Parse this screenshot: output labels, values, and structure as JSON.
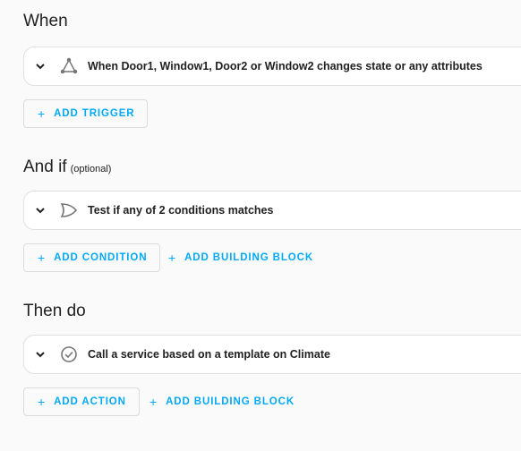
{
  "triggers": {
    "title": "When",
    "card_text": "When Door1, Window1, Door2 or Window2 changes state or any attributes",
    "card_icon": "trigger-state-icon",
    "add_trigger_label": "ADD TRIGGER"
  },
  "conditions": {
    "title": "And if",
    "subtitle": "(optional)",
    "card_text": "Test if any of 2 conditions matches",
    "card_icon": "or-gate-icon",
    "add_condition_label": "ADD CONDITION",
    "add_building_block_label": "ADD BUILDING BLOCK"
  },
  "actions": {
    "title": "Then do",
    "card_text": "Call a service based on a template on Climate",
    "card_icon": "check-circle-icon",
    "add_action_label": "ADD ACTION",
    "add_building_block_label": "ADD BUILDING BLOCK"
  },
  "colors": {
    "accent": "#03a9f4",
    "text": "#212121",
    "background": "#fafafa",
    "card_border": "#e0e0e0"
  },
  "icons": {
    "expand": "chevron-down-icon",
    "add": "plus-icon"
  }
}
